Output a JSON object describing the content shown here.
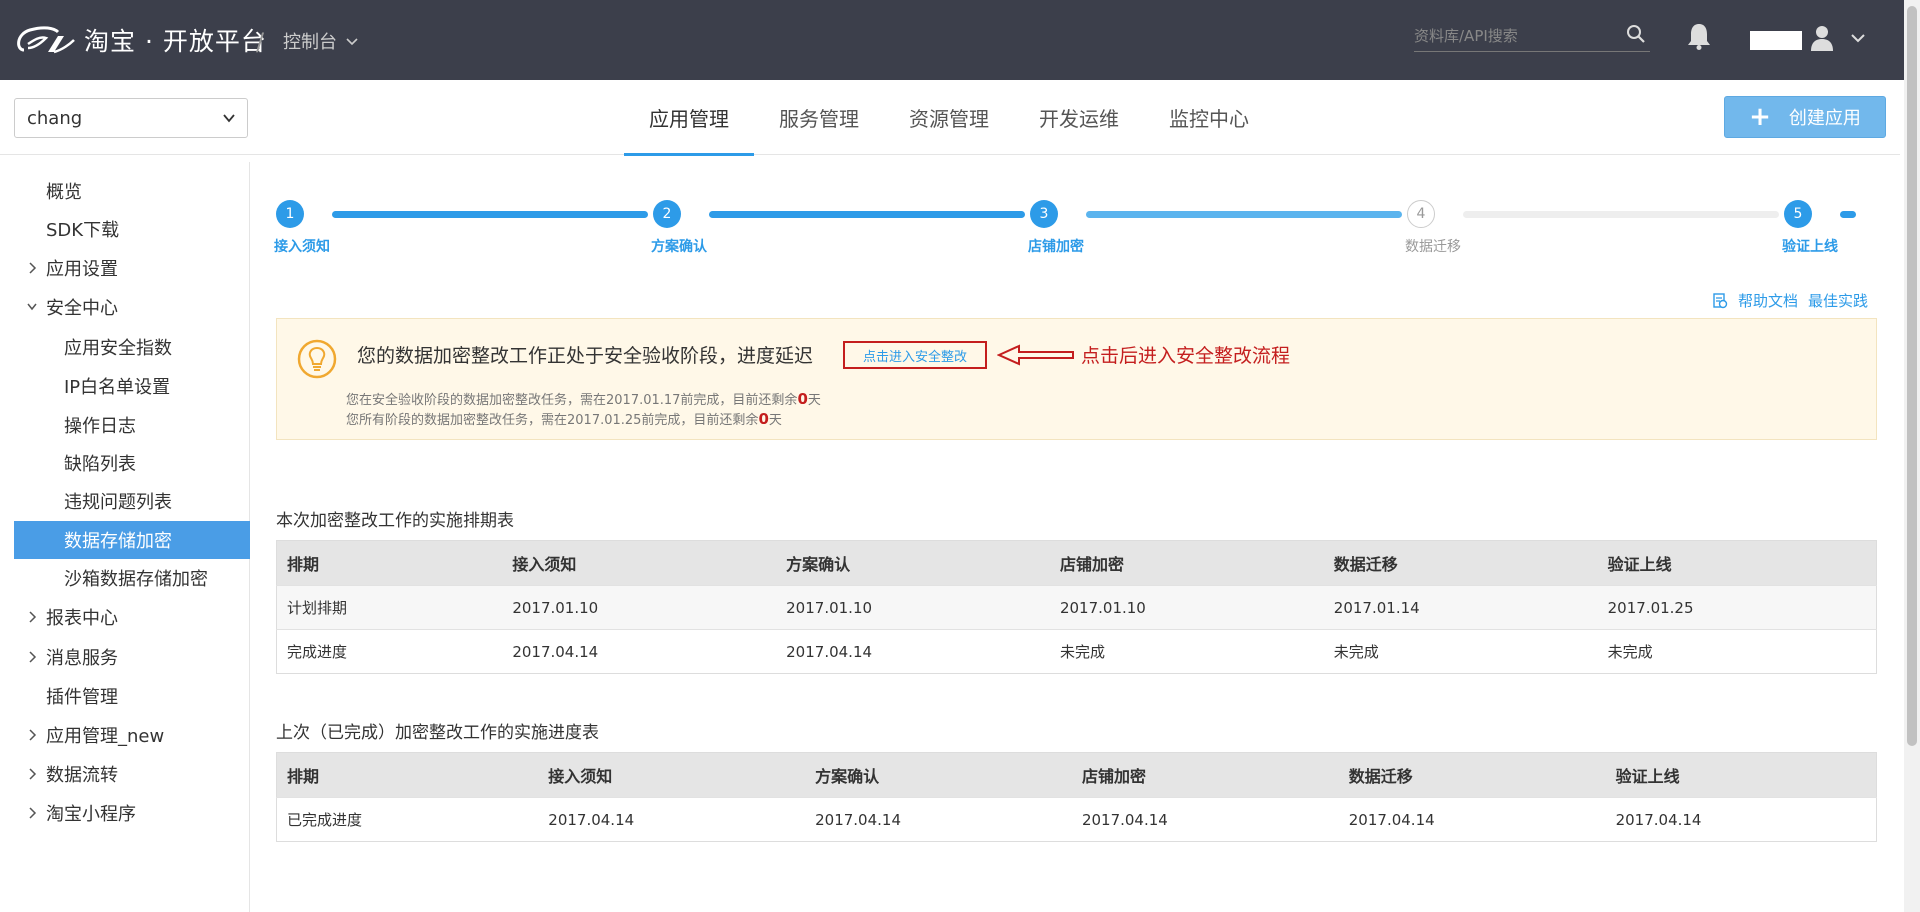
{
  "header": {
    "brand": "淘宝 · 开放平台",
    "separator": "/",
    "console": "控制台",
    "search_placeholder": "资料库/API搜索"
  },
  "subbar": {
    "app_select_value": "chang",
    "nav": [
      "应用管理",
      "服务管理",
      "资源管理",
      "开发运维",
      "监控中心"
    ],
    "active_nav": "应用管理",
    "create_button": "创建应用"
  },
  "sidebar": {
    "items": [
      {
        "label": "概览",
        "chevron": "none",
        "sub": false,
        "active": false
      },
      {
        "label": "SDK下载",
        "chevron": "none",
        "sub": false,
        "active": false
      },
      {
        "label": "应用设置",
        "chevron": "right",
        "sub": false,
        "active": false
      },
      {
        "label": "安全中心",
        "chevron": "down",
        "sub": false,
        "active": false
      },
      {
        "label": "应用安全指数",
        "chevron": "none",
        "sub": true,
        "active": false
      },
      {
        "label": "IP白名单设置",
        "chevron": "none",
        "sub": true,
        "active": false
      },
      {
        "label": "操作日志",
        "chevron": "none",
        "sub": true,
        "active": false
      },
      {
        "label": "缺陷列表",
        "chevron": "none",
        "sub": true,
        "active": false
      },
      {
        "label": "违规问题列表",
        "chevron": "none",
        "sub": true,
        "active": false
      },
      {
        "label": "数据存储加密",
        "chevron": "none",
        "sub": true,
        "active": true
      },
      {
        "label": "沙箱数据存储加密",
        "chevron": "none",
        "sub": true,
        "active": false
      },
      {
        "label": "报表中心",
        "chevron": "right",
        "sub": false,
        "active": false
      },
      {
        "label": "消息服务",
        "chevron": "right",
        "sub": false,
        "active": false
      },
      {
        "label": "插件管理",
        "chevron": "none",
        "sub": false,
        "active": false
      },
      {
        "label": "应用管理_new",
        "chevron": "right",
        "sub": false,
        "active": false
      },
      {
        "label": "数据流转",
        "chevron": "right",
        "sub": false,
        "active": false
      },
      {
        "label": "淘宝小程序",
        "chevron": "right",
        "sub": false,
        "active": false
      }
    ]
  },
  "steps": [
    {
      "num": "1",
      "label": "接入须知",
      "done": true
    },
    {
      "num": "2",
      "label": "方案确认",
      "done": true
    },
    {
      "num": "3",
      "label": "店铺加密",
      "done": true
    },
    {
      "num": "4",
      "label": "数据迁移",
      "done": false
    },
    {
      "num": "5",
      "label": "验证上线",
      "done": true
    }
  ],
  "doc_links": {
    "help": "帮助文档",
    "best": "最佳实践"
  },
  "alert": {
    "title": "您的数据加密整改工作正处于安全验收阶段，进度延迟",
    "link": "点击进入安全整改",
    "annotation": "点击后进入安全整改流程",
    "line1_pre": "您在安全验收阶段的数据加密整改任务，需在2017.01.17前完成，目前还剩余",
    "line1_num": "0",
    "line1_post": "天",
    "line2_pre": "您所有阶段的数据加密整改任务，需在2017.01.25前完成，目前还剩余",
    "line2_num": "0",
    "line2_post": "天"
  },
  "table1": {
    "title": "本次加密整改工作的实施排期表",
    "headers": [
      "排期",
      "接入须知",
      "方案确认",
      "店铺加密",
      "数据迁移",
      "验证上线"
    ],
    "rows": [
      [
        "计划排期",
        "2017.01.10",
        "2017.01.10",
        "2017.01.10",
        "2017.01.14",
        "2017.01.25"
      ],
      [
        "完成进度",
        "2017.04.14",
        "2017.04.14",
        "未完成",
        "未完成",
        "未完成"
      ]
    ]
  },
  "table2": {
    "title": "上次（已完成）加密整改工作的实施进度表",
    "headers": [
      "排期",
      "接入须知",
      "方案确认",
      "店铺加密",
      "数据迁移",
      "验证上线"
    ],
    "rows": [
      [
        "已完成进度",
        "2017.04.14",
        "2017.04.14",
        "2017.04.14",
        "2017.04.14",
        "2017.04.14"
      ]
    ]
  },
  "colors": {
    "accent": "#2d9be8",
    "header_bg": "#3c3f4b",
    "alert_bg": "#fff8e8",
    "warn_red": "#c41e1e"
  }
}
